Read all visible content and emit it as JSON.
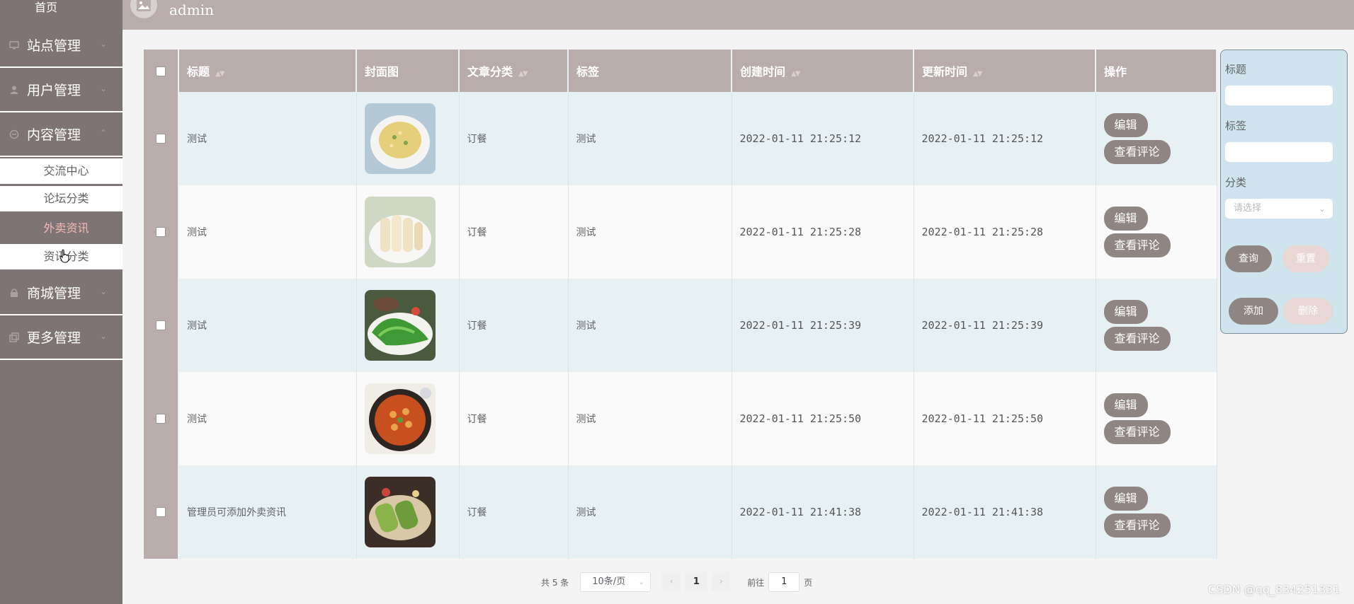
{
  "sidebar": {
    "home": "首页",
    "groups": [
      {
        "label": "站点管理",
        "icon": "monitor-icon"
      },
      {
        "label": "用户管理",
        "icon": "user-icon"
      },
      {
        "label": "内容管理",
        "icon": "chat-icon"
      },
      {
        "label": "商城管理",
        "icon": "lock-icon"
      },
      {
        "label": "更多管理",
        "icon": "copy-icon"
      }
    ],
    "sub_items": [
      "交流中心",
      "论坛分类",
      "外卖资讯",
      "资讯分类"
    ],
    "active_sub": "外卖资讯"
  },
  "header": {
    "user": "admin"
  },
  "table": {
    "columns": [
      "标题",
      "封面图",
      "文章分类",
      "标签",
      "创建时间",
      "更新时间",
      "操作"
    ],
    "rows": [
      {
        "title": "测试",
        "category": "订餐",
        "tag": "测试",
        "created": "2022-01-11 21:25:12",
        "updated": "2022-01-11 21:25:12"
      },
      {
        "title": "测试",
        "category": "订餐",
        "tag": "测试",
        "created": "2022-01-11 21:25:28",
        "updated": "2022-01-11 21:25:28"
      },
      {
        "title": "测试",
        "category": "订餐",
        "tag": "测试",
        "created": "2022-01-11 21:25:39",
        "updated": "2022-01-11 21:25:39"
      },
      {
        "title": "测试",
        "category": "订餐",
        "tag": "测试",
        "created": "2022-01-11 21:25:50",
        "updated": "2022-01-11 21:25:50"
      },
      {
        "title": "管理员可添加外卖资讯",
        "category": "订餐",
        "tag": "测试",
        "created": "2022-01-11 21:41:38",
        "updated": "2022-01-11 21:41:38"
      }
    ],
    "edit_label": "编辑",
    "comment_label": "查看评论"
  },
  "search": {
    "title_label": "标题",
    "tag_label": "标签",
    "category_label": "分类",
    "category_placeholder": "请选择",
    "query": "查询",
    "reset": "重置",
    "add": "添加",
    "delete": "删除"
  },
  "pagination": {
    "total": "共 5 条",
    "page_size": "10条/页",
    "current": "1",
    "goto": "前往",
    "goto_value": "1",
    "page_unit": "页"
  },
  "watermark": "CSDN @qq_834251331",
  "colors": {
    "sidebar_bg": "#7d7473",
    "header_bg": "#b8adab",
    "button_bg": "#8f8684",
    "active_text": "#f4b8b8",
    "panel_bg": "#cfe4ec"
  }
}
